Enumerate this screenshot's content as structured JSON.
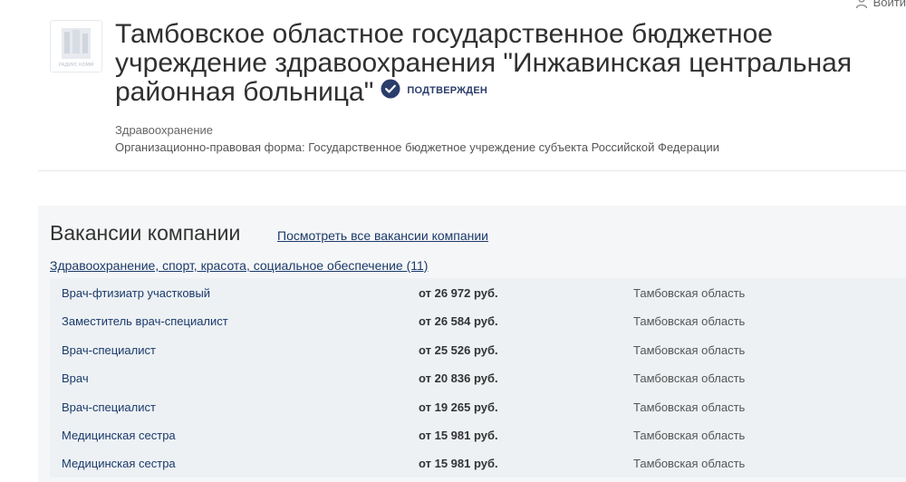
{
  "header": {
    "login_label": "Войти"
  },
  "company": {
    "logo_text": "РАДИУС КОММ",
    "name": "Тамбовское областное государственное бюджетное учреждение здравоохранения \"Инжавинская центральная районная больница\"",
    "verified_label": "ПОДТВЕРЖДЕН",
    "industry": "Здравоохранение",
    "legal_form": "Организационно-правовая форма: Государственное бюджетное учреждение субъекта Российской Федерации"
  },
  "vacancies": {
    "title": "Вакансии компании",
    "all_link": "Посмотреть все вакансии компании",
    "category": "Здравоохранение, спорт, красота, социальное обеспечение (11)",
    "rows": [
      {
        "name": "Врач-фтизиатр участковый",
        "salary": "от 26 972 руб.",
        "region": "Тамбовская область"
      },
      {
        "name": "Заместитель врач-специалист",
        "salary": "от 26 584 руб.",
        "region": "Тамбовская область"
      },
      {
        "name": "Врач-специалист",
        "salary": "от 25 526 руб.",
        "region": "Тамбовская область"
      },
      {
        "name": "Врач",
        "salary": "от 20 836 руб.",
        "region": "Тамбовская область"
      },
      {
        "name": "Врач-специалист",
        "salary": "от 19 265 руб.",
        "region": "Тамбовская область"
      },
      {
        "name": "Медицинская сестра",
        "salary": "от 15 981 руб.",
        "region": "Тамбовская область"
      },
      {
        "name": "Медицинская сестра",
        "salary": "от 15 981 руб.",
        "region": "Тамбовская область"
      }
    ]
  },
  "colors": {
    "link": "#1b3a6a",
    "verified_badge": "#2b3d6b",
    "table_bg": "#edf1f4"
  }
}
